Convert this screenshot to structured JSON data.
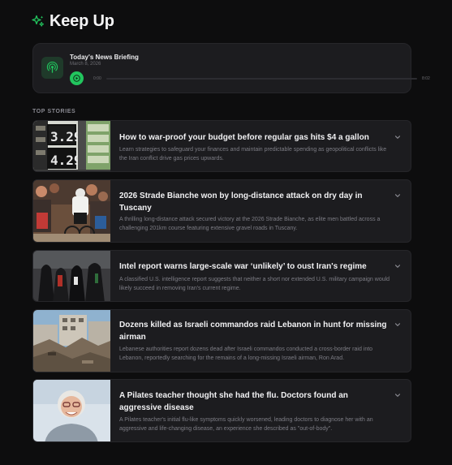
{
  "header": {
    "title": "Keep Up",
    "logo_icon": "sparkle-icon",
    "accent_color": "#22c55e"
  },
  "briefing": {
    "title": "Today's News Briefing",
    "date": "March 8, 2026",
    "time_start": "0:00",
    "time_end": "8:02",
    "progress": 0,
    "icon": "podcast-icon"
  },
  "section_label": "TOP STORIES",
  "stories": [
    {
      "title": "How to war-proof your budget before regular gas hits $4 a gallon",
      "description": "Learn strategies to safeguard your finances and maintain predictable spending as geopolitical conflicts like the Iran conflict drive gas prices upwards."
    },
    {
      "title": "2026 Strade Bianche won by long-distance attack on dry day in Tuscany",
      "description": "A thrilling long-distance attack secured victory at the 2026 Strade Bianche, as elite men battled across a challenging 201km course featuring extensive gravel roads in Tuscany."
    },
    {
      "title": "Intel report warns large-scale war ‘unlikely’ to oust Iran's regime",
      "description": "A classified U.S. intelligence report suggests that neither a short nor extended U.S. military campaign would likely succeed in removing Iran's current regime."
    },
    {
      "title": "Dozens killed as Israeli commandos raid Lebanon in hunt for missing airman",
      "description": "Lebanese authorities report dozens dead after Israeli commandos conducted a cross-border raid into Lebanon, reportedly searching for the remains of a long-missing Israeli airman, Ron Arad."
    },
    {
      "title": "A Pilates teacher thought she had the flu. Doctors found an aggressive disease",
      "description": "A Pilates teacher's initial flu-like symptoms quickly worsened, leading doctors to diagnose her with an aggressive and life-changing disease, an experience she described as \"out-of-body\"."
    }
  ]
}
